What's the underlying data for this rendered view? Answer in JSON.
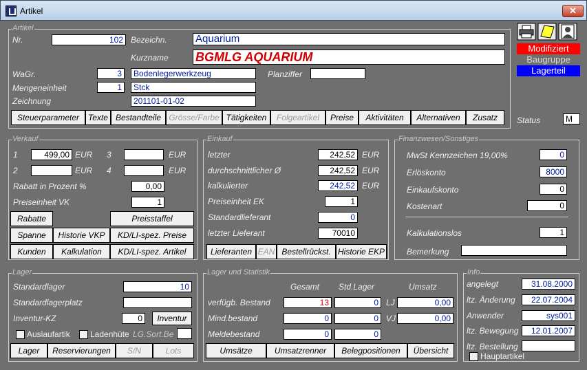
{
  "window": {
    "title": "Artikel",
    "close": "✕"
  },
  "artikel": {
    "group": "Artikel",
    "nr_label": "Nr.",
    "nr": "102",
    "bez_label": "Bezeichn.",
    "bez": "Aquarium",
    "kurz_label": "Kurzname",
    "kurz": "BGMLG AQUARIUM",
    "wagr_label": "WaGr.",
    "wagr": "3",
    "wagr_text": "Bodenlegerwerkzeug",
    "planziffer_label": "Planziffer",
    "planziffer": "",
    "me_label": "Mengeneinheit",
    "me": "1",
    "me_text": "Stck",
    "zeich_label": "Zeichnung",
    "zeich": "201101-01-02",
    "tabs": [
      "Steuerparameter",
      "Texte",
      "Bestandteile",
      "Grösse/Farbe",
      "Tätigkeiten",
      "Folgeartikel",
      "Preise",
      "Aktivitäten",
      "Alternativen",
      "Zusatz"
    ],
    "status_label": "Status",
    "status": "M"
  },
  "flags": {
    "modifiziert": "Modifiziert",
    "baugruppe": "Baugruppe",
    "lagerteil": "Lagerteil"
  },
  "verkauf": {
    "group": "Verkauf",
    "p1_label": "1",
    "p1": "499,00",
    "p1_cur": "EUR",
    "p2_label": "2",
    "p2": "",
    "p2_cur": "EUR",
    "p3_label": "3",
    "p3": "",
    "p3_cur": "EUR",
    "p4_label": "4",
    "p4": "",
    "p4_cur": "EUR",
    "rabatt_label": "Rabatt in Prozent %",
    "rabatt": "0,00",
    "pe_label": "Preiseinheit VK",
    "pe": "1",
    "buttons": [
      "Rabatte",
      "Preisstaffel",
      "Spanne",
      "Historie VKP",
      "KD/LI-spez. Preise",
      "Kunden",
      "Kalkulation",
      "KD/LI-spez. Artikel"
    ]
  },
  "einkauf": {
    "group": "Einkauf",
    "letzter_label": "letzter",
    "letzter": "242,52",
    "letzter_cur": "EUR",
    "durch_label": "durchschnittlicher Ø",
    "durch": "242,52",
    "durch_cur": "EUR",
    "kalk_label": "kalkulierter",
    "kalk": "242,52",
    "kalk_cur": "EUR",
    "pe_label": "Preiseinheit EK",
    "pe": "1",
    "std_label": "Standardlieferant",
    "std": "0",
    "letzt_lief_label": "letzter Lieferant",
    "letzt_lief": "70010",
    "buttons": [
      "Lieferanten",
      "EAN",
      "Bestellrückst.",
      "Historie EKP"
    ]
  },
  "finanz": {
    "group": "Finanzwesen/Sonstiges",
    "mwst_label": "MwSt Kennzeichen 19,00%",
    "mwst": "0",
    "erl_label": "Erlöskonto",
    "erl": "8000",
    "eink_label": "Einkaufskonto",
    "eink": "0",
    "kost_label": "Kostenart",
    "kost": "0",
    "kalklos_label": "Kalkulationslos",
    "kalklos": "1",
    "bem_label": "Bemerkung",
    "bem": ""
  },
  "lager": {
    "group": "Lager",
    "std_label": "Standardlager",
    "std": "10",
    "platz_label": "Standardlagerplatz",
    "platz": "",
    "inv_label": "Inventur-KZ",
    "inv": "0",
    "inv_btn": "Inventur",
    "auslauf": "Auslaufartik",
    "laden": "Ladenhüte",
    "lgsort_label": "LG.Sort.Be",
    "lgsort": "",
    "buttons": [
      "Lager",
      "Reservierungen",
      "S/N",
      "Lots"
    ]
  },
  "stat": {
    "group": "Lager und Statistik",
    "h_gesamt": "Gesamt",
    "h_std": "Std.Lager",
    "h_ums": "Umsatz",
    "verf_label": "verfügb. Bestand",
    "verf_g": "13",
    "verf_s": "0",
    "lj_label": "LJ",
    "lj": "0,00",
    "mind_label": "Mind.bestand",
    "mind_g": "0",
    "mind_s": "0",
    "vj_label": "VJ",
    "vj": "0,00",
    "melde_label": "Meldebestand",
    "melde_g": "0",
    "melde_s": "0",
    "buttons": [
      "Umsätze",
      "Umsatzrenner",
      "Belegpositionen",
      "Übersicht"
    ]
  },
  "info": {
    "group": "Info",
    "angelegt_label": "angelegt",
    "angelegt": "31.08.2000",
    "aend_label": "ltz. Änderung",
    "aend": "22.07.2004",
    "anw_label": "Anwender",
    "anw": "sys001",
    "beweg_label": "ltz. Bewegung",
    "beweg": "12.01.2007",
    "best_label": "ltz. Bestellung",
    "best": "",
    "haupt": "Hauptartikel"
  },
  "toolbar": {
    "printer": "printer-icon",
    "note": "note-icon",
    "person": "person-icon"
  }
}
